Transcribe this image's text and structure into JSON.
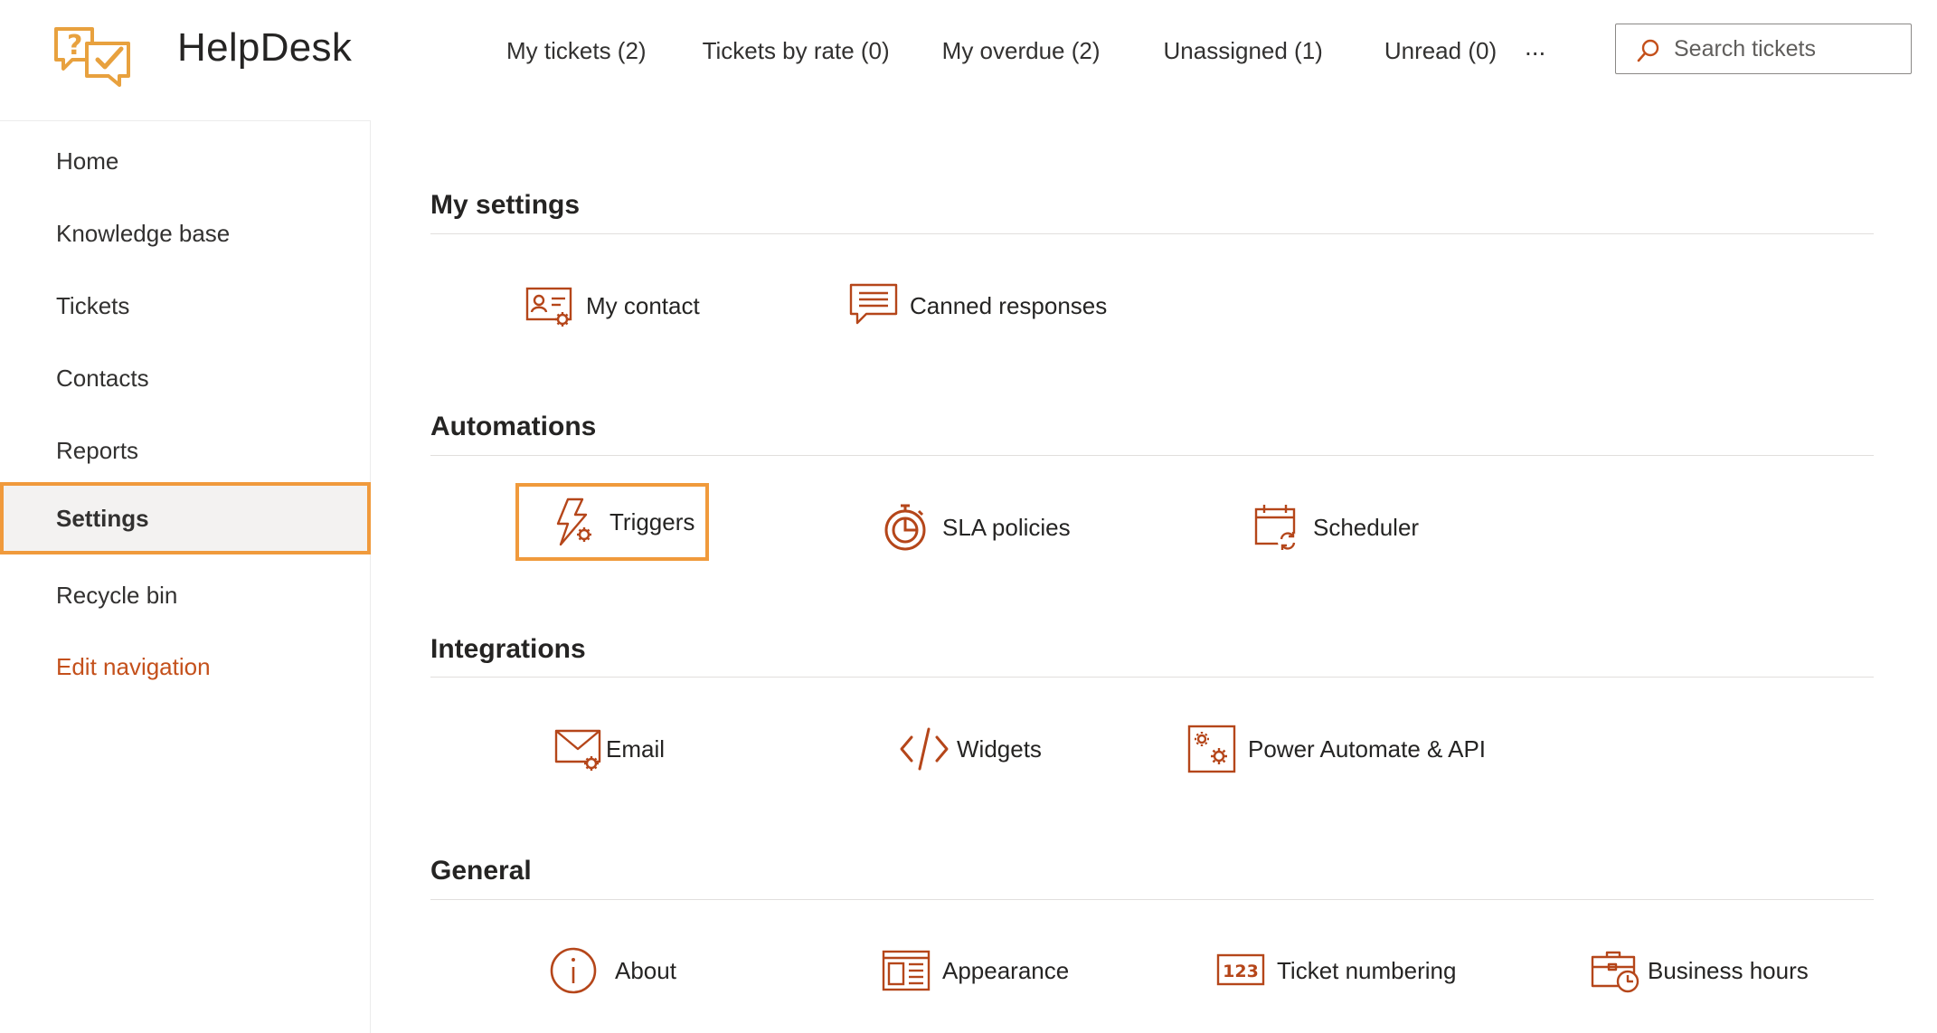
{
  "app": {
    "title": "HelpDesk",
    "logo_icon": "helpdesk-chat-check-logo"
  },
  "topnav": {
    "items": [
      "My tickets (2)",
      "Tickets by rate (0)",
      "My overdue (2)",
      "Unassigned (1)",
      "Unread (0)"
    ],
    "more": "..."
  },
  "search": {
    "placeholder": "Search tickets",
    "icon": "search-icon"
  },
  "sidebar": {
    "items": [
      "Home",
      "Knowledge base",
      "Tickets",
      "Contacts",
      "Reports",
      "Settings",
      "Recycle bin"
    ],
    "active": "Settings",
    "edit_link": "Edit navigation"
  },
  "sections": [
    {
      "title": "My settings",
      "tiles": [
        {
          "label": "My contact",
          "icon": "contact-card-gear-icon"
        },
        {
          "label": "Canned responses",
          "icon": "chat-lines-icon"
        }
      ]
    },
    {
      "title": "Automations",
      "tiles": [
        {
          "label": "Triggers",
          "icon": "lightning-gear-icon"
        },
        {
          "label": "SLA policies",
          "icon": "stopwatch-icon"
        },
        {
          "label": "Scheduler",
          "icon": "calendar-refresh-icon"
        }
      ]
    },
    {
      "title": "Integrations",
      "tiles": [
        {
          "label": "Email",
          "icon": "envelope-gear-icon"
        },
        {
          "label": "Widgets",
          "icon": "code-brackets-icon"
        },
        {
          "label": "Power Automate & API",
          "icon": "gears-window-icon"
        }
      ]
    },
    {
      "title": "General",
      "tiles": [
        {
          "label": "About",
          "icon": "info-circle-icon"
        },
        {
          "label": "Appearance",
          "icon": "layout-panels-icon"
        },
        {
          "label": "Ticket numbering",
          "icon": "numbers-123-icon"
        },
        {
          "label": "Business hours",
          "icon": "briefcase-clock-icon"
        }
      ]
    }
  ],
  "highlighted_tile": "Triggers",
  "colors": {
    "accent": "#f09a3c",
    "icon": "#b5461a",
    "link": "#c4501b",
    "active_bg": "#f3f2f1"
  }
}
